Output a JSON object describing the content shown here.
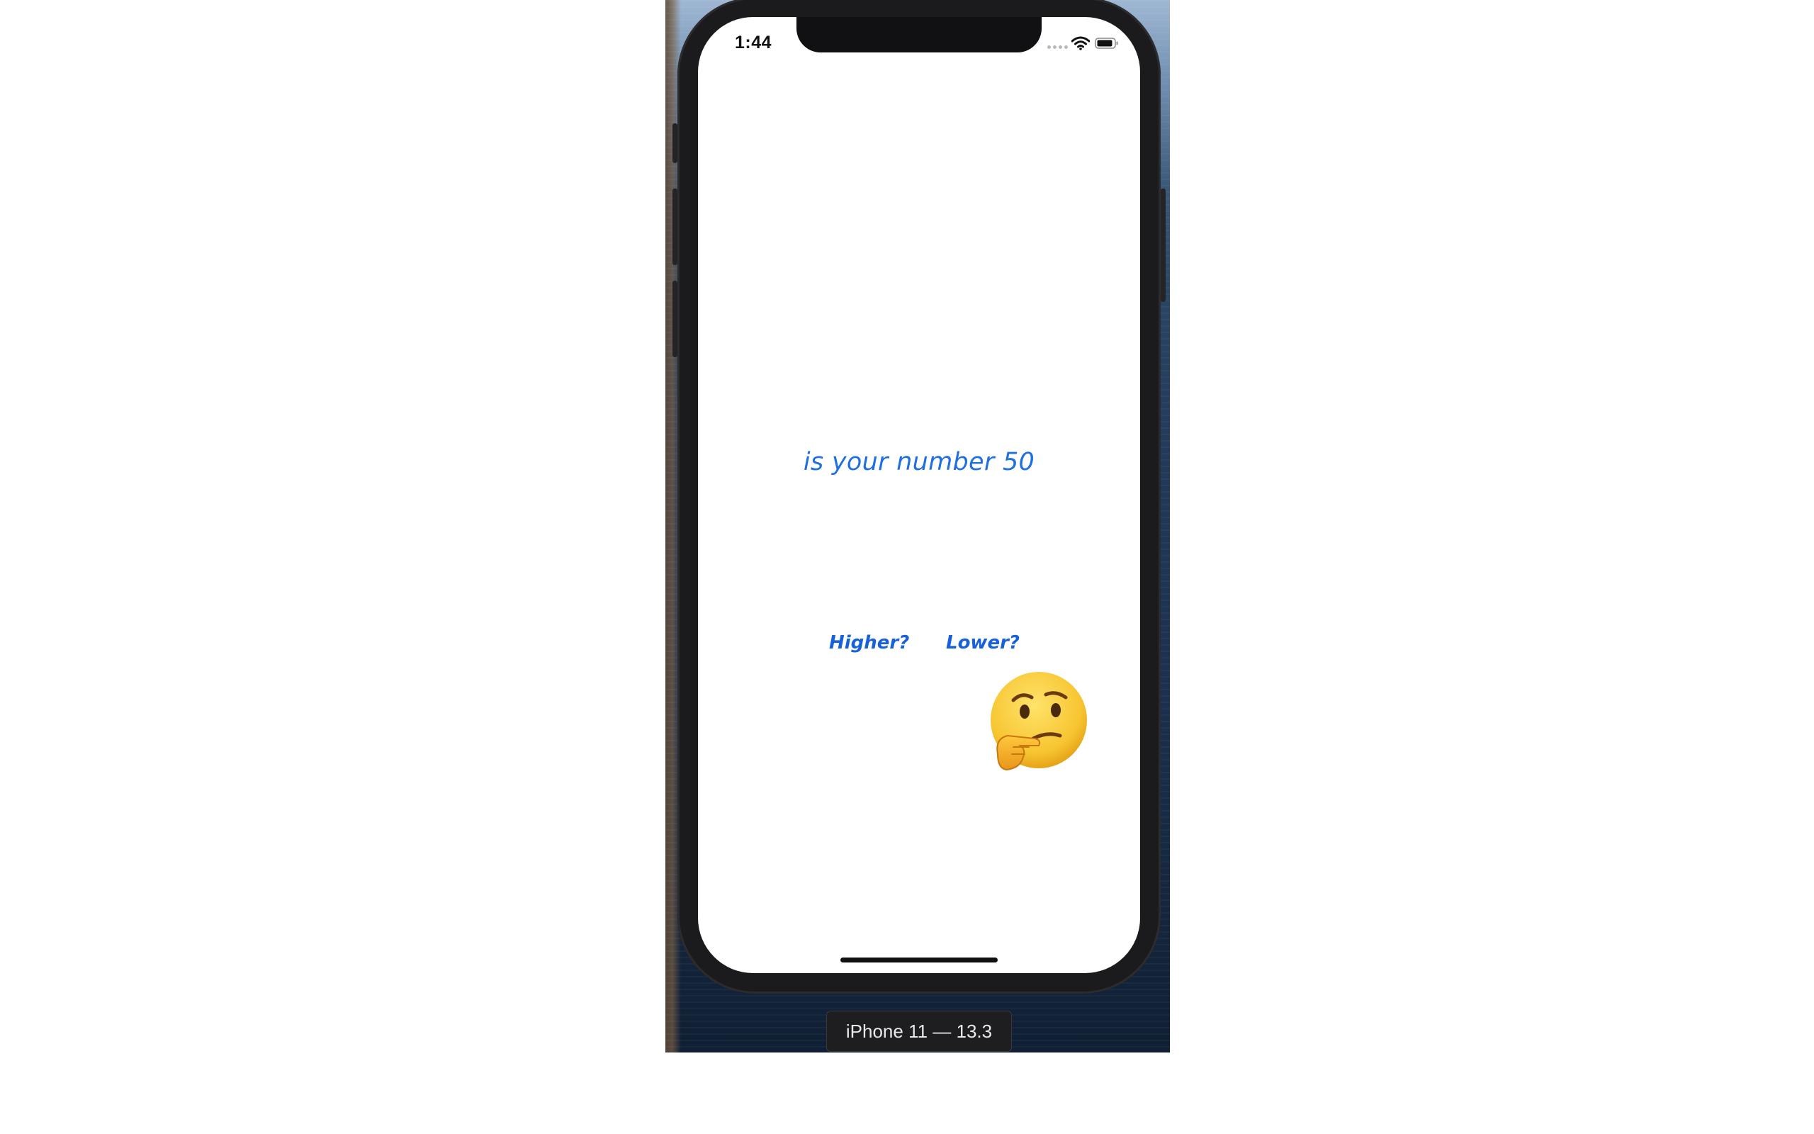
{
  "simulator": {
    "device_label": "iPhone 11 — 13.3"
  },
  "status_bar": {
    "time": "1:44",
    "icons": [
      "cellular-signal-icon",
      "wifi-icon",
      "battery-icon"
    ]
  },
  "app": {
    "question": "is your number 50",
    "higher_label": "Higher?",
    "lower_label": "Lower?",
    "thinking_icon": "thinking-face-icon",
    "accent_color": "#1f6fe0"
  }
}
